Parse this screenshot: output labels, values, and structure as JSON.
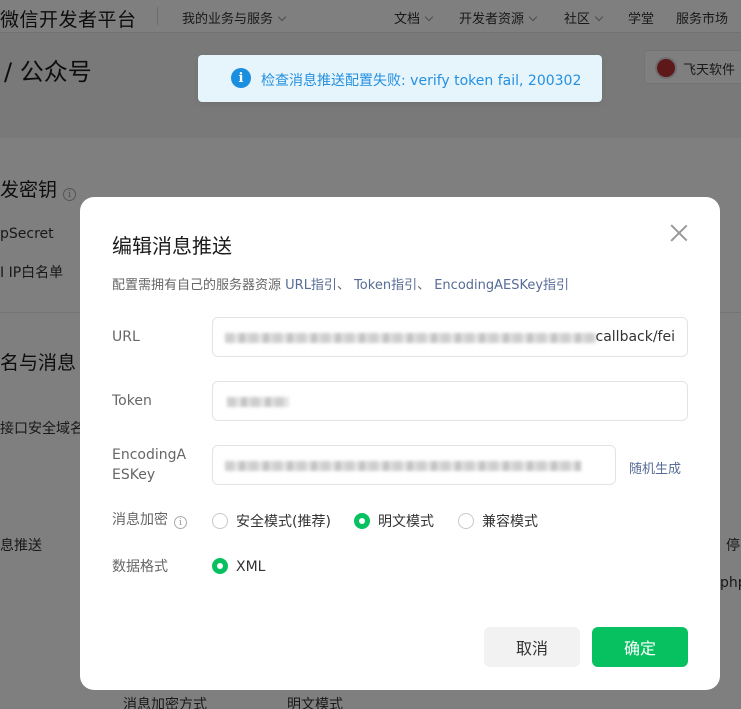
{
  "topbar": {
    "brand": "微信开发者平台",
    "nav": [
      "我的业务与服务",
      "文档",
      "开发者资源",
      "社区",
      "学堂",
      "服务市场"
    ]
  },
  "page": {
    "title": "/ 公众号",
    "user_name": "飞天软件"
  },
  "background": {
    "section1_title": "发密钥",
    "appsecret_label": "pSecret",
    "ip_whitelist_label": "I IP白名单",
    "section2_title": "名与消息",
    "domain_label": "接口安全域名",
    "msg_push_label": "息推送",
    "stop_text": "停",
    "php_text": "php",
    "encrypt_method_label": "消息加密方式",
    "encrypt_method_value": "明文模式"
  },
  "toast": {
    "text": "检查消息推送配置失败: verify token fail, 200302",
    "color": "#2590e0"
  },
  "dialog": {
    "title": "编辑消息推送",
    "desc_prefix": "配置需拥有自己的服务器资源 ",
    "guide_links": [
      "URL指引",
      "Token指引",
      "EncodingAESKey指引"
    ],
    "url_label": "URL",
    "url_value_tail": "callback/fei",
    "token_label": "Token",
    "aeskey_label_line1": "EncodingA",
    "aeskey_label_line2": "ESKey",
    "random_generate": "随机生成",
    "encrypt_label": "消息加密",
    "encrypt_options": [
      "安全模式(推荐)",
      "明文模式",
      "兼容模式"
    ],
    "encrypt_selected": "明文模式",
    "format_label": "数据格式",
    "format_options": [
      "XML"
    ],
    "format_selected": "XML",
    "cancel_label": "取消",
    "ok_label": "确定",
    "accent_color": "#07c160"
  }
}
